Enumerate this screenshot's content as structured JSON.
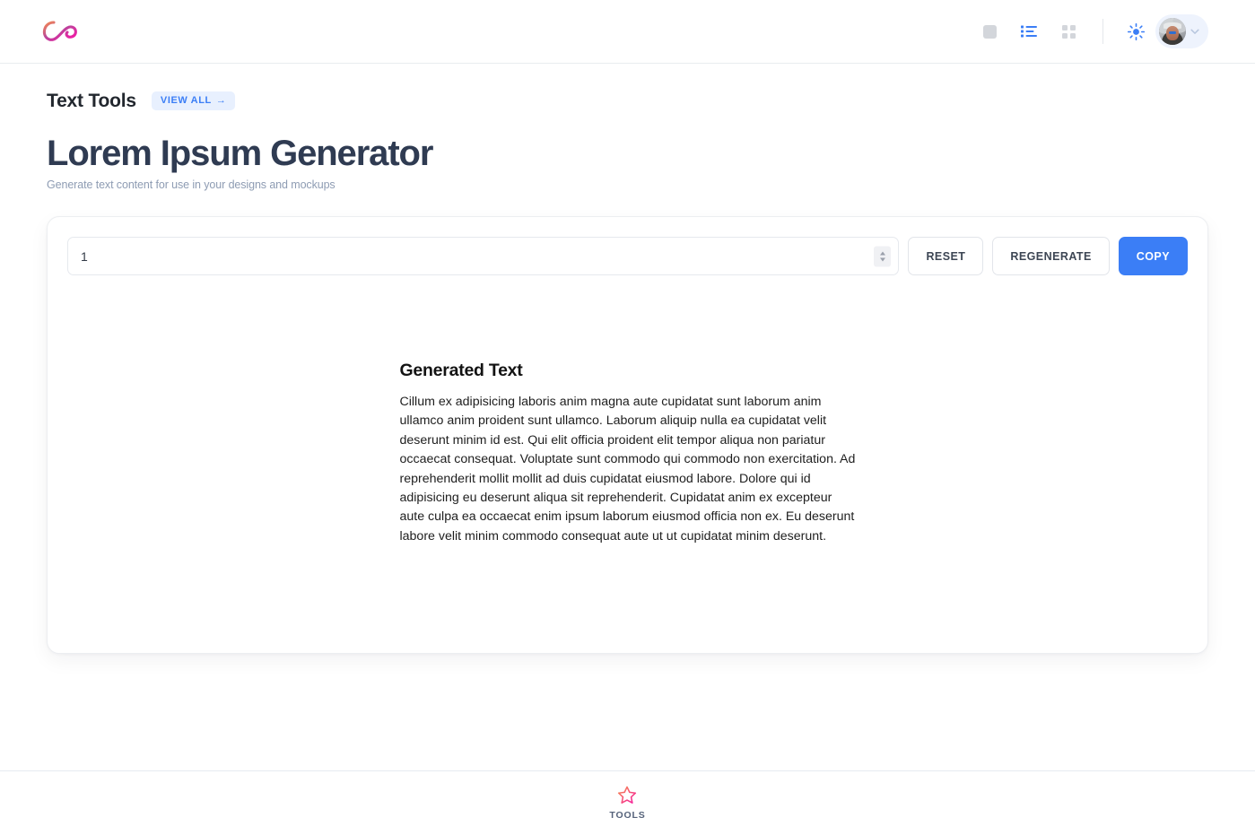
{
  "header": {
    "logo_name": "infinity-swoosh-logo",
    "icons": [
      {
        "name": "placeholder-square-icon",
        "state": "inactive"
      },
      {
        "name": "list-view-icon",
        "state": "active"
      },
      {
        "name": "grid-view-icon",
        "state": "inactive"
      },
      {
        "name": "theme-sun-icon",
        "state": "active"
      }
    ],
    "account": {
      "avatar_alt": "user avatar",
      "chevron": "chevron-down-icon"
    },
    "colors": {
      "accent_blue": "#3b7ef6",
      "inactive_gray": "#d3d6db",
      "pill_bg": "#eef3fd"
    }
  },
  "breadcrumb": {
    "category": "Text Tools",
    "view_all_label": "VIEW ALL",
    "view_all_arrow": "→"
  },
  "hero": {
    "title": "Lorem Ipsum Generator",
    "subtitle": "Generate text content for use in your designs and mockups"
  },
  "tool": {
    "count_value": "1",
    "count_placeholder": "1",
    "buttons": {
      "reset": "RESET",
      "regenerate": "REGENERATE",
      "copy": "COPY"
    },
    "result": {
      "heading": "Generated Text",
      "text": "Cillum ex adipisicing laboris anim magna aute cupidatat sunt laborum anim ullamco anim proident sunt ullamco. Laborum aliquip nulla ea cupidatat velit deserunt minim id est. Qui elit officia proident elit tempor aliqua non pariatur occaecat consequat. Voluptate sunt commodo qui commodo non exercitation. Ad reprehenderit mollit mollit ad duis cupidatat eiusmod labore. Dolore qui id adipisicing eu deserunt aliqua sit reprehenderit. Cupidatat anim ex excepteur aute culpa ea occaecat enim ipsum laborum eiusmod officia non ex. Eu deserunt labore velit minim commodo consequat aute ut ut cupidatat minim deserunt."
    }
  },
  "footer": {
    "item_label": "TOOLS",
    "item_icon": "star-outline-icon"
  }
}
